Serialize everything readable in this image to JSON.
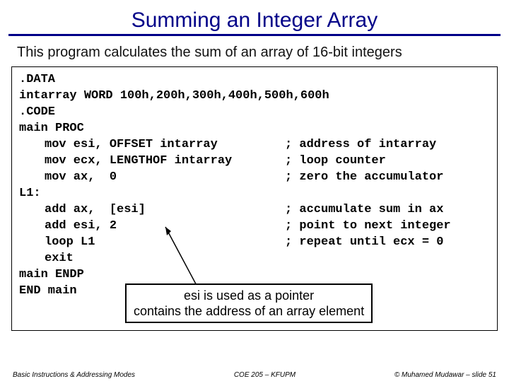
{
  "title": "Summing an Integer Array",
  "subtitle": "This program calculates the sum of an array of 16-bit integers",
  "code": {
    "l1": ".DATA",
    "l2": "intarray WORD 100h,200h,300h,400h,500h,600h",
    "l3": ".CODE",
    "l4": "main PROC",
    "l5_inst": "mov esi, OFFSET intarray",
    "l5_comm": "; address of intarray",
    "l6_inst": "mov ecx, LENGTHOF intarray",
    "l6_comm": "; loop counter",
    "l7_inst": "mov ax,  0",
    "l7_comm": "; zero the accumulator",
    "l8": "L1:",
    "l9_inst": "add ax,  [esi]",
    "l9_comm": "; accumulate sum in ax",
    "l10_inst": "add esi, 2",
    "l10_comm": "; point to next integer",
    "l11_inst": "loop L1",
    "l11_comm": "; repeat until ecx = 0",
    "l12_inst": "exit",
    "l13": "main ENDP",
    "l14": "END main"
  },
  "callout": {
    "line1": "esi is used as a pointer",
    "line2": "contains the address of an array element"
  },
  "footer": {
    "left": "Basic Instructions & Addressing Modes",
    "center": "COE 205 – KFUPM",
    "right": "© Muhamed Mudawar – slide 51"
  }
}
